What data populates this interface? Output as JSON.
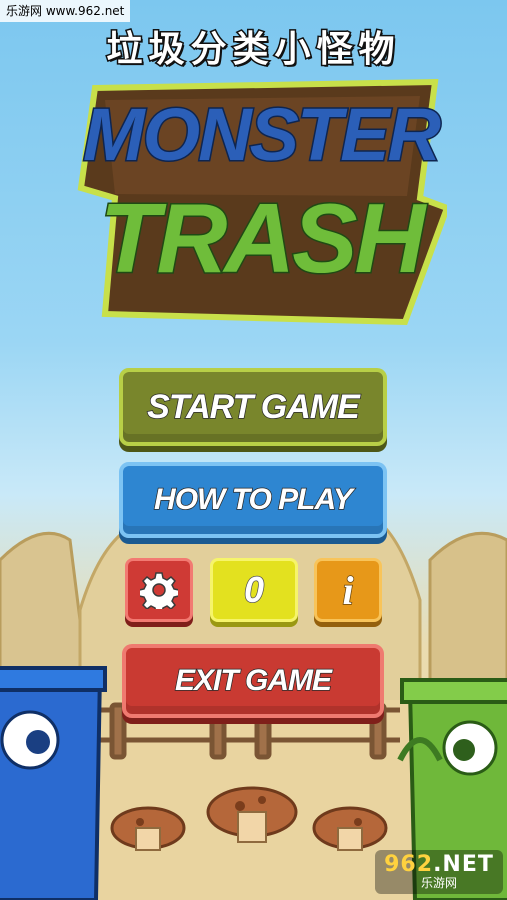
{
  "watermark_top": "乐游网 www.962.net",
  "watermark_bottom": {
    "logo_main": "962",
    "logo_suffix": ".NET",
    "sub": "乐游网"
  },
  "title_cn": "垃圾分类小怪物",
  "logo": {
    "line1": "MONSTER",
    "line2": "TRASH"
  },
  "menu": {
    "start_label": "START GAME",
    "how_label": "HOW TO PLAY",
    "score_value": "0",
    "info_label": "i",
    "exit_label": "EXIT GAME"
  },
  "icons": {
    "settings": "gear-icon",
    "info": "info-icon"
  },
  "colors": {
    "start": "#79862c",
    "how": "#2e86d1",
    "settings": "#cf3a35",
    "score": "#e3e11f",
    "info": "#e79819",
    "exit": "#c93a32"
  }
}
